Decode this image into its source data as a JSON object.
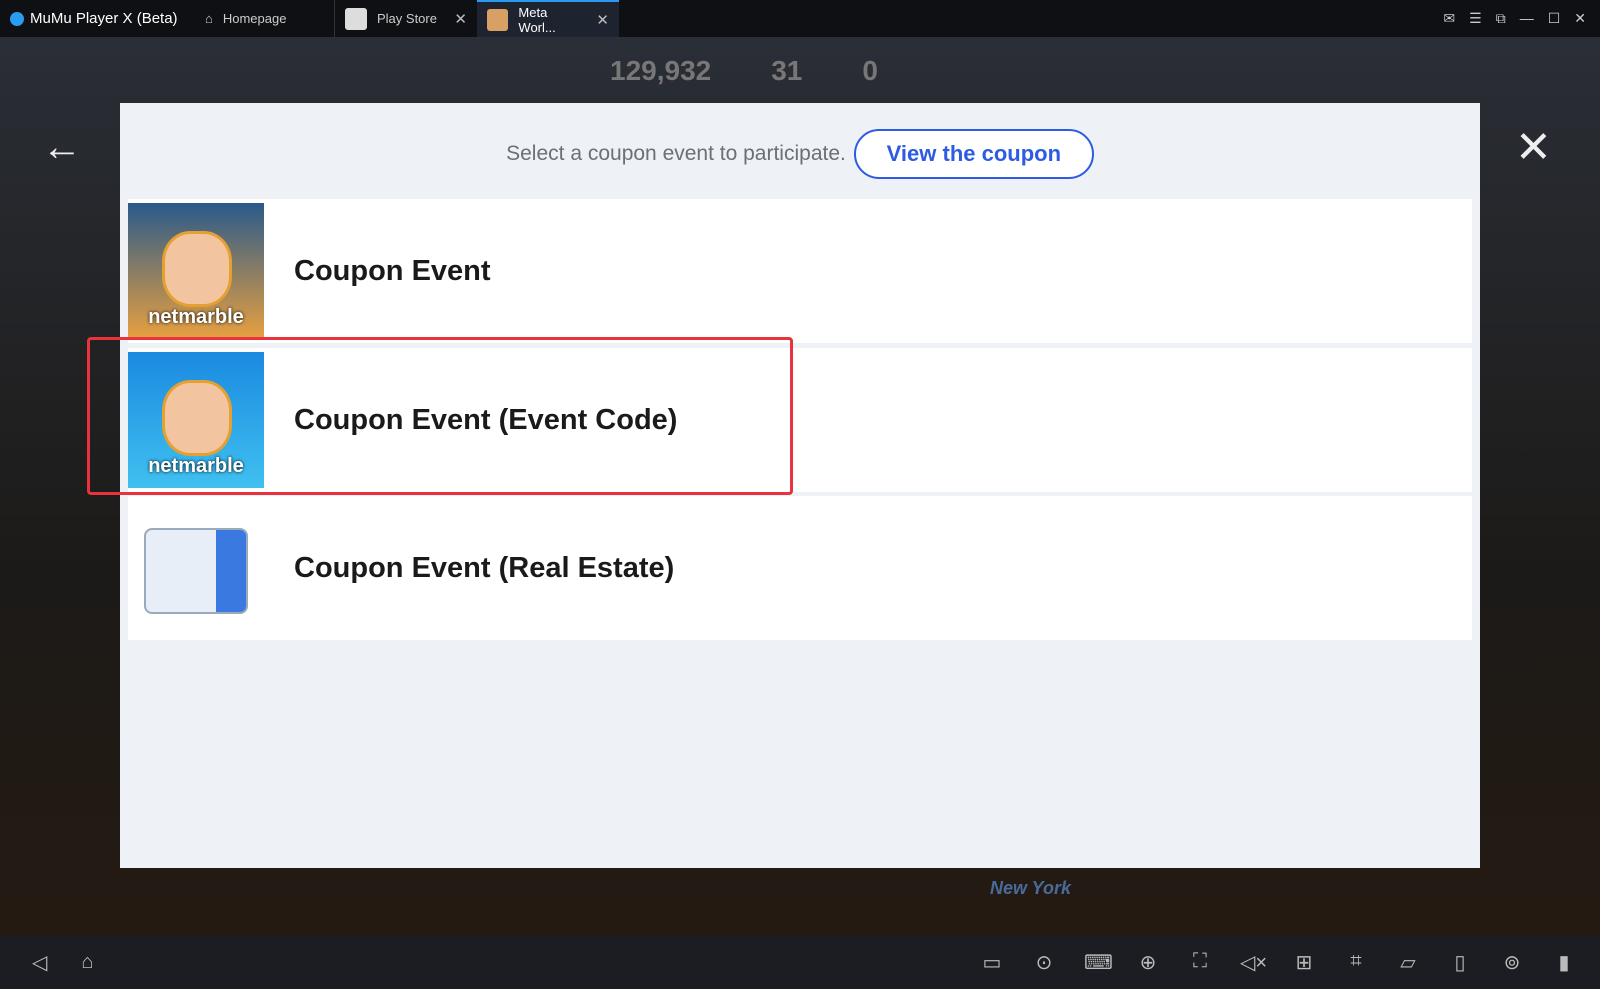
{
  "titlebar": {
    "app_name": "MuMu Player X  (Beta)",
    "tabs": [
      {
        "label": "Homepage"
      },
      {
        "label": "Play Store"
      },
      {
        "label": "Meta Worl..."
      }
    ]
  },
  "hud": {
    "gold": "129,932",
    "gems": "31",
    "red_gems": "0",
    "location": "New York"
  },
  "dialog": {
    "prompt": "Select a coupon event to participate.",
    "view_button": "View the coupon",
    "items": [
      {
        "label": "Coupon Event",
        "thumb_text": "netmarble"
      },
      {
        "label": "Coupon Event (Event Code)",
        "thumb_text": "netmarble"
      },
      {
        "label": "Coupon Event (Real Estate)"
      }
    ]
  },
  "colors": {
    "accent": "#2d5be3",
    "highlight": "#e8323c"
  }
}
